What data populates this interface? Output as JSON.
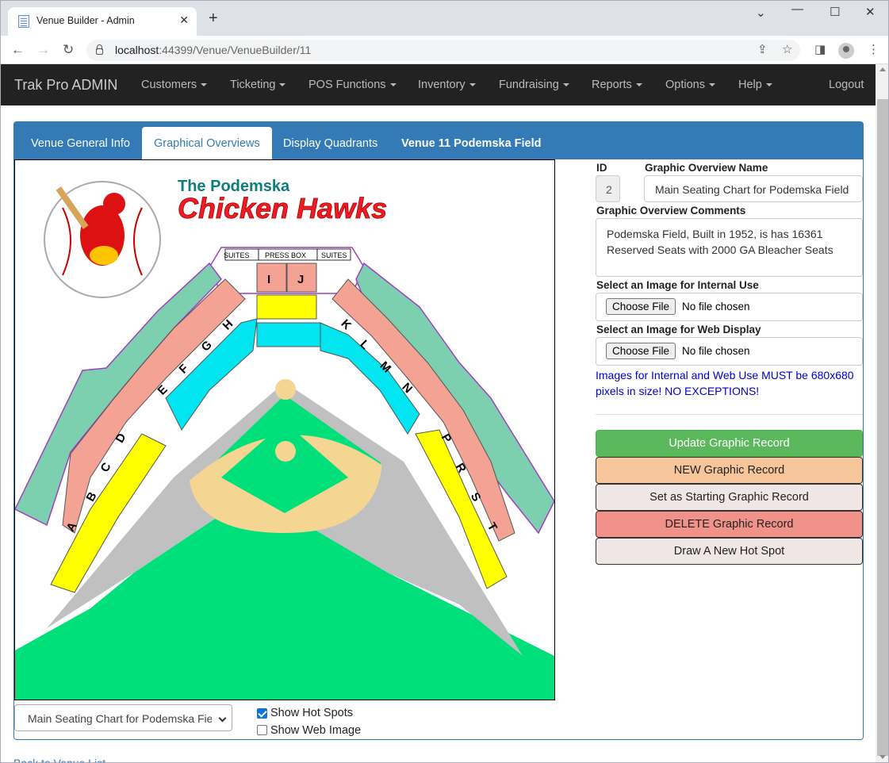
{
  "browser": {
    "tab_title": "Venue Builder - Admin",
    "url_host": "localhost",
    "url_rest": ":44399/Venue/VenueBuilder/11"
  },
  "navbar": {
    "brand": "Trak Pro ADMIN",
    "menus": [
      "Customers",
      "Ticketing",
      "POS Functions",
      "Inventory",
      "Fundraising",
      "Reports",
      "Options",
      "Help"
    ],
    "logout": "Logout"
  },
  "panel": {
    "tabs": [
      "Venue General Info",
      "Graphical Overviews",
      "Display Quadrants"
    ],
    "venue_title": "Venue 11 Podemska Field"
  },
  "map": {
    "team_line1": "The Podemska",
    "team_line2": "Chicken Hawks",
    "suites": "SUITES",
    "press_box": "PRESS BOX",
    "sections_letters": [
      "A",
      "B",
      "C",
      "D",
      "E",
      "F",
      "G",
      "H",
      "I",
      "J",
      "K",
      "L",
      "M",
      "N",
      "P",
      "R",
      "S",
      "T"
    ]
  },
  "form": {
    "id_label": "ID",
    "id_value": "2",
    "name_label": "Graphic Overview Name",
    "name_value": "Main Seating Chart for Podemska Field",
    "comments_label": "Graphic Overview Comments",
    "comments_value": "Podemska Field, Built in 1952, is has 16361 Reserved Seats with 2000 GA Bleacher Seats",
    "internal_label": "Select an Image for Internal Use",
    "web_label": "Select an Image for Web Display",
    "choose_file": "Choose File",
    "no_file": "No file chosen",
    "note": "Images for Internal and Web Use MUST be 680x680 pixels in size! NO EXCEPTIONS!"
  },
  "buttons": {
    "update": "Update Graphic Record",
    "new": "NEW Graphic Record",
    "starting": "Set as Starting Graphic Record",
    "delete": "DELETE Graphic Record",
    "hotspot": "Draw A New Hot Spot"
  },
  "bottom": {
    "select_value": "Main Seating Chart for Podemska Field",
    "show_hot_spots": "Show Hot Spots",
    "show_web_image": "Show Web Image",
    "back_link": "Back to Venue List"
  },
  "colors": {
    "navbar": "#222222",
    "panel_header": "#337ab7",
    "update_btn": "#5cb85c",
    "new_btn": "#f7c59a",
    "delete_btn": "#f0928a",
    "neutral_btn": "#f0e6e6",
    "field_green": "#00e07a",
    "infield_tan": "#f5d592",
    "seat_teal": "#7ccfaf",
    "seat_salmon": "#f4a294",
    "seat_yellow": "#ffff00",
    "seat_cyan": "#00e5f0"
  }
}
